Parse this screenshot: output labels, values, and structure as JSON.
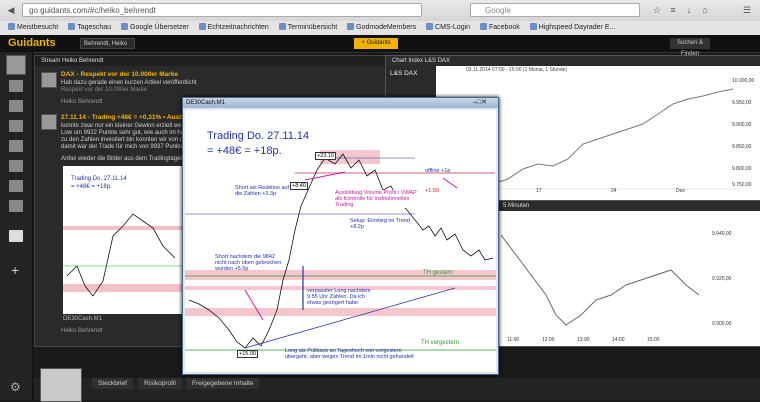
{
  "browser": {
    "url": "go.guidants.com/#c/heiko_behrendt",
    "search_placeholder": "Google",
    "bookmarks": [
      "Meistbesucht",
      "Tageschau",
      "Google Übersetzer",
      "Echtzeitnachrichten",
      "Terminübersicht",
      "GodmodeMembers",
      "CMS-Login",
      "Facebook",
      "Highspeed Dayrader E..."
    ]
  },
  "app": {
    "logo": "Guidants",
    "workspace": "Behrendt, Heiko",
    "add_button": "+ Guidants Master",
    "settings": "Suchen & Finden"
  },
  "stream": {
    "title": "Stream Heiko Behrendt",
    "post1": {
      "title": "DAX - Respekt vor der 10.000er Marke",
      "text": "Hab dazu gerade einen kurzen Artikel veröffentlicht",
      "sub": "Respekt vor der 10.000er Marke",
      "author": "Heiko Behrendt"
    },
    "post2": {
      "title": "27.11.14 - Trading +48€ = +0,31% • Ausbildu",
      "line1": "konnte zwar nur ein kleiner Gewinn erzielt wer",
      "line2": "Low um 9922 Punkte sehr gut, wie auch im he",
      "line3": "zu den Zahlen investiert bin konnten wir von d",
      "line4": "damit war der Trade für mich von 9937 Punkte",
      "line5": "Anbei wieder die Bilder aus dem Tradingtagebu",
      "author": "Heiko Behrendt"
    }
  },
  "right_top": {
    "title": "Chart Index L&S DAX",
    "symbol": "L&S DAX",
    "date": "03.11.2014 07:00 - 15:00 (1 Monat, 1 Stunde)",
    "y_labels": [
      "10.000,00",
      "9.950,00",
      "9.900,00",
      "9.850,00",
      "9.800,00",
      "9.750,00"
    ],
    "x_labels": [
      "17",
      "24",
      "Dez"
    ]
  },
  "right_bot": {
    "title": "5 Minuten",
    "y_labels": [
      "9.940,00",
      "9.920,00",
      "9.900,00"
    ],
    "x_labels": [
      "11:00",
      "12:00",
      "13:00",
      "14:00",
      "15:00"
    ]
  },
  "main_window": {
    "title": "DE30Cash,M1",
    "heading1": "Trading Do. 27.11.14",
    "heading2": "= +48€ = +18p.",
    "ann_short_reaktion": "Short als Reaktion auf die Zahlen +3.3p",
    "ann_short_nach": "Short nachdem die 9842 nicht nach oben gebrochen wurden +5.5p",
    "ann_ausbildung": "Ausbildung Volume Profil / VWAP als Kontrolle für institutionelles Trading",
    "ann_setup": "Setup: Einstieg im Trend +8.2p",
    "ann_offline": "offline +1p",
    "ann_verpasster": "verpasster Long nachdem 9.55 Uhr Zahlen. Da ich etwas gezögert habe",
    "ann_long_pullback": "Long als Pullback an Tageshoch von vorgestern übergeht, aber wegen Trend im 1min nicht gehandelt",
    "th_gestern": "TH gestern",
    "th_vorgestern": "TH vorgestern",
    "box1": "+23.10",
    "box2": "+8.40",
    "box3": "+1.50",
    "box4": "+15.00"
  },
  "tabs": [
    "Steckbrief",
    "Risikoprofil",
    "Freigegebene Inhalte"
  ]
}
